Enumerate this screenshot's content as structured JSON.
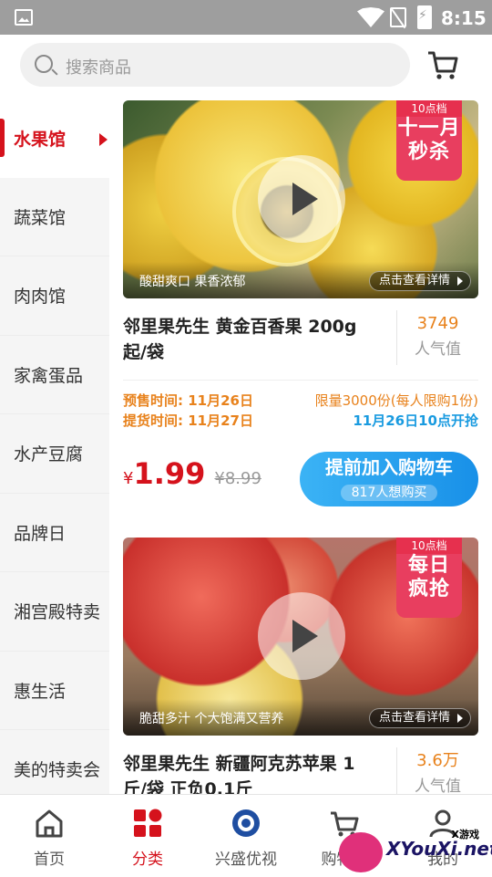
{
  "status_bar": {
    "time": "8:15"
  },
  "search": {
    "placeholder": "搜索商品"
  },
  "sidebar": {
    "items": [
      {
        "label": "水果馆",
        "active": true
      },
      {
        "label": "蔬菜馆"
      },
      {
        "label": "肉肉馆"
      },
      {
        "label": "家禽蛋品"
      },
      {
        "label": "水产豆腐"
      },
      {
        "label": "品牌日"
      },
      {
        "label": "湘宫殿特卖"
      },
      {
        "label": "惠生活"
      },
      {
        "label": "美的特卖会"
      }
    ]
  },
  "products": [
    {
      "tag_small": "10点档",
      "tag_big_1": "十一月",
      "tag_big_2": "秒杀",
      "caption": "酸甜爽口 果香浓郁",
      "detail_link": "点击查看详情",
      "title": "邻里果先生 黄金百香果 200g起/袋",
      "popularity": "3749",
      "popularity_label": "人气值",
      "presale": "预售时间: 11月26日",
      "pickup": "提货时间: 11月27日",
      "limit": "限量3000份(每人限购1份)",
      "start": "11月26日10点开抢",
      "currency": "¥",
      "price": "1.99",
      "old_price": "¥8.99",
      "buy_label": "提前加入购物车",
      "want": "817人想购买"
    },
    {
      "tag_small": "10点档",
      "tag_big_1": "每日",
      "tag_big_2": "疯抢",
      "caption": "脆甜多汁 个大饱满又营养",
      "detail_link": "点击查看详情",
      "title": "邻里果先生 新疆阿克苏苹果 1斤/袋 正负0.1斤",
      "popularity": "3.6万",
      "popularity_label": "人气值"
    }
  ],
  "bottom_nav": [
    {
      "label": "首页",
      "icon": "home-icon"
    },
    {
      "label": "分类",
      "icon": "category-icon",
      "active": true
    },
    {
      "label": "兴盛优视",
      "icon": "video-icon"
    },
    {
      "label": "购物车",
      "icon": "cart-icon"
    },
    {
      "label": "我的",
      "icon": "profile-icon"
    }
  ],
  "watermark": {
    "small": "X游戏",
    "text": "XYouXi.net"
  },
  "colors": {
    "accent": "#d5121c",
    "orange": "#e8821c",
    "blue": "#1a9be0"
  }
}
